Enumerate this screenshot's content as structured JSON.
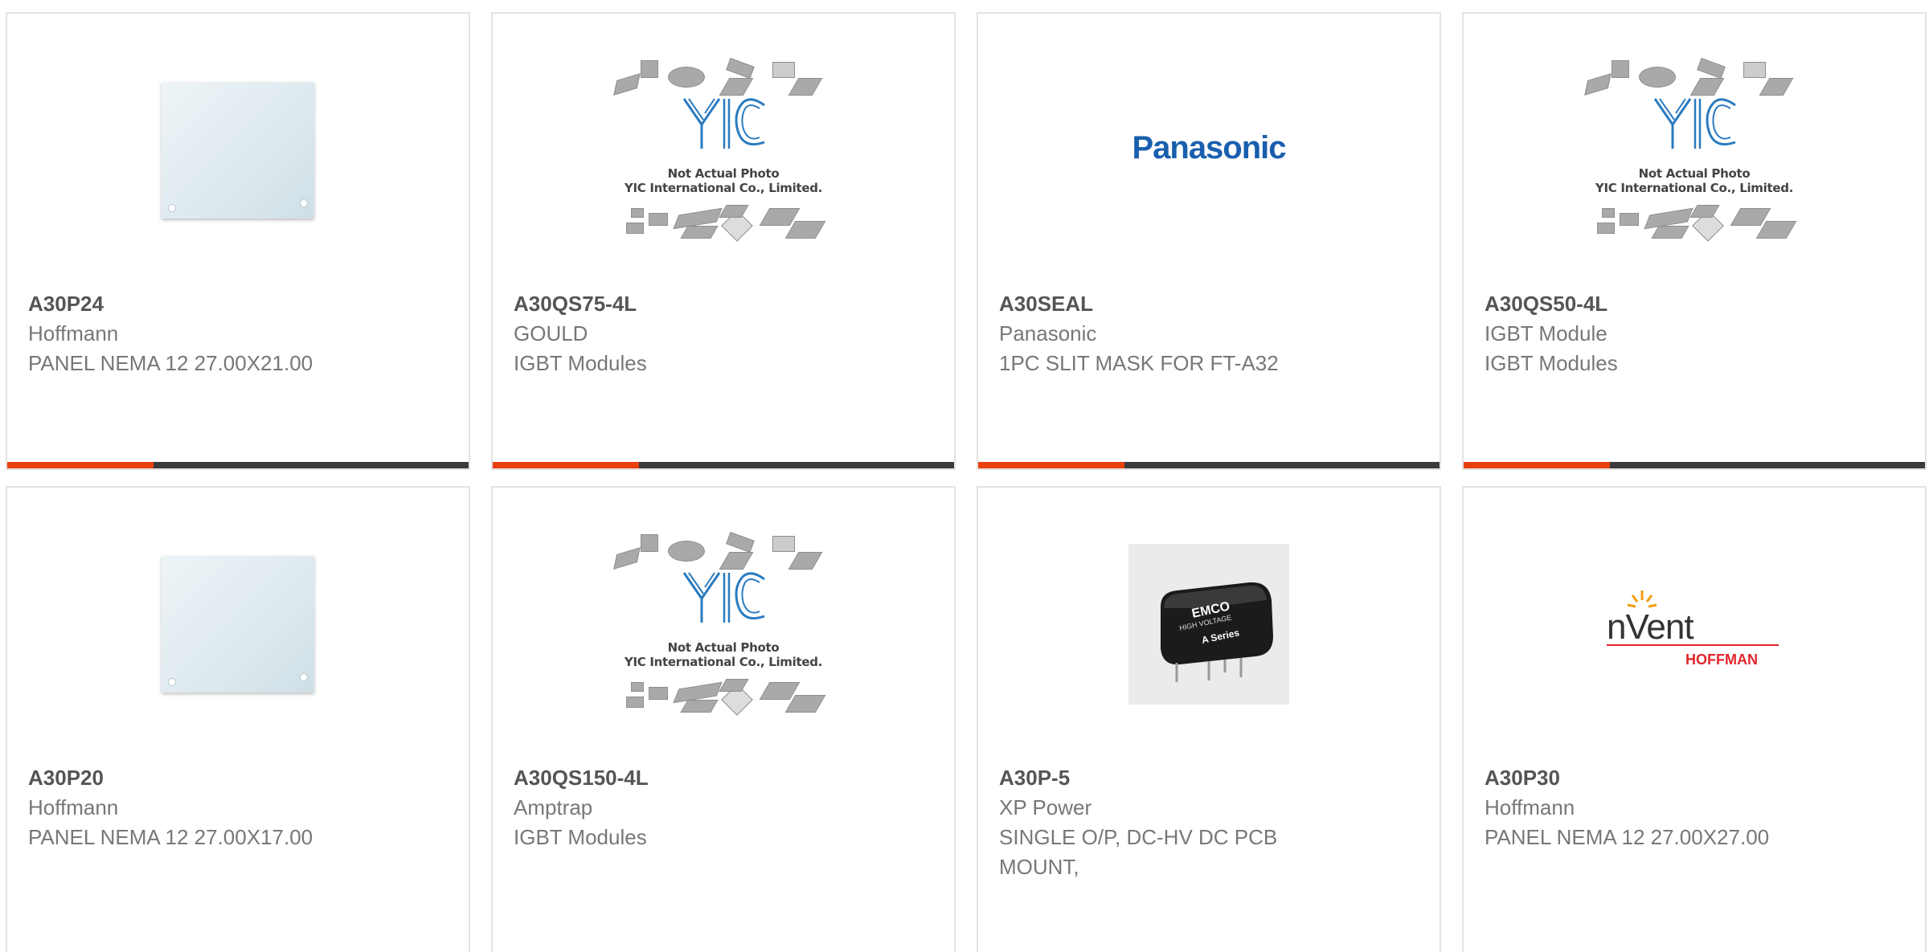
{
  "products": [
    {
      "part": "A30P24",
      "manufacturer": "Hoffmann",
      "description": "PANEL NEMA 12 27.00X21.00",
      "image": "panel-photo"
    },
    {
      "part": "A30QS75-4L",
      "manufacturer": "GOULD",
      "description": "IGBT Modules",
      "image": "yic-placeholder"
    },
    {
      "part": "A30SEAL",
      "manufacturer": "Panasonic",
      "description": "1PC SLIT MASK FOR FT-A32",
      "image": "panasonic-logo"
    },
    {
      "part": "A30QS50-4L",
      "manufacturer": "IGBT Module",
      "description": "IGBT Modules",
      "image": "yic-placeholder"
    },
    {
      "part": "A30P20",
      "manufacturer": "Hoffmann",
      "description": "PANEL NEMA 12 27.00X17.00",
      "image": "panel-photo"
    },
    {
      "part": "A30QS150-4L",
      "manufacturer": "Amptrap",
      "description": "IGBT Modules",
      "image": "yic-placeholder"
    },
    {
      "part": "A30P-5",
      "manufacturer": "XP Power",
      "description": "SINGLE O/P, DC-HV DC PCB MOUNT,",
      "image": "emco-module-photo"
    },
    {
      "part": "A30P30",
      "manufacturer": "Hoffmann",
      "description": "PANEL NEMA 12 27.00X27.00",
      "image": "nvent-hoffman-logo"
    }
  ],
  "placeholder": {
    "line1": "Not Actual Photo",
    "line2": "YIC International Co., Limited."
  },
  "logos": {
    "panasonic": "Panasonic",
    "nvent": "nVent",
    "hoffman": "HOFFMAN",
    "emco": "EMCO",
    "emco_sub1": "HIGH VOLTAGE",
    "emco_sub2": "A Series"
  },
  "colors": {
    "accent": "#e8410e",
    "bar": "#3b3b3b",
    "border": "#e3e3e3",
    "panasonic_blue": "#1a5fae",
    "yic_blue": "#2a7bc0",
    "hoffman_red": "#e0262b"
  }
}
